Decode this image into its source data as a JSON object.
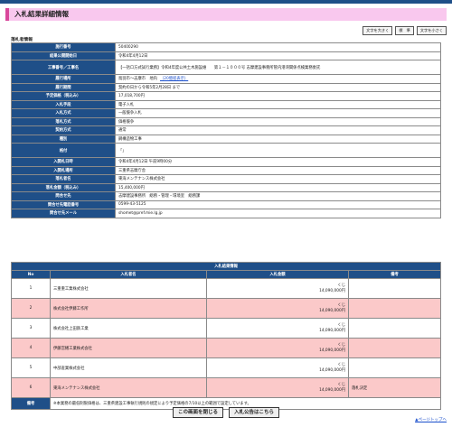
{
  "header": {
    "title": "入札結果詳細情報"
  },
  "font_size_buttons": [
    "文字を大きく",
    "標　準",
    "文字を小さく"
  ],
  "section_label": "落札者情報",
  "info_rows": [
    {
      "label": "施行番号",
      "value": "50400290"
    },
    {
      "label": "結果公開開始日",
      "value": "令和4年4月12日"
    },
    {
      "label": "工事番号／工事名",
      "value": "【一括ロ方式試行業務】令和4年度公共土木施設維　　第１－１０００号 志摩建設事務所管内港湾関係点検業務委託",
      "tall": true
    },
    {
      "label": "履行場所",
      "value": "鳥羽市～志摩市　地内",
      "link": "（20億程表示）"
    },
    {
      "label": "履行期間",
      "value": "契約の日から令和5年2月28日 まで"
    },
    {
      "label": "予定価格（税込み）",
      "value": "17,018,700円"
    },
    {
      "label": "入札手段",
      "value": "電子入札"
    },
    {
      "label": "入札方式",
      "value": "一般競争入札"
    },
    {
      "label": "落札方式",
      "value": "価格競争"
    },
    {
      "label": "契約方式",
      "value": "通常"
    },
    {
      "label": "種別",
      "value": "鋼構造物工事"
    },
    {
      "label": "格付",
      "value": "「」",
      "tall": true
    },
    {
      "label": "入開札日時",
      "value": "令和4年4月12日 午前9時00分"
    },
    {
      "label": "入開札場所",
      "value": "三重県志摩庁舎"
    },
    {
      "label": "落札者名",
      "value": "東海メンテナンス株式会社"
    },
    {
      "label": "落札金額（税込み）",
      "value": "15,400,000円"
    },
    {
      "label": "問合せ先",
      "value": "志摩建設事務所　総務・管理・環境室　総務課"
    },
    {
      "label": "問合せ先電話番号",
      "value": "0599-43-5125"
    },
    {
      "label": "問合せ先メール",
      "value": "shomet@pref.mie.lg.jp"
    }
  ],
  "results": {
    "caption": "入札結果情報",
    "columns": [
      "No",
      "入札者名",
      "入札金額",
      "備考"
    ],
    "rows": [
      {
        "no": "1",
        "name": "三重重工業株式会社",
        "amount_line1": "くじ",
        "amount_line2": "14,090,000円",
        "note": ""
      },
      {
        "no": "2",
        "name": "株式会社伊藤工作所",
        "amount_line1": "くじ",
        "amount_line2": "14,090,000円",
        "note": ""
      },
      {
        "no": "3",
        "name": "株式会社上田鉄工業",
        "amount_line1": "くじ",
        "amount_line2": "14,090,000円",
        "note": ""
      },
      {
        "no": "4",
        "name": "伊藤営繕工業株式会社",
        "amount_line1": "くじ",
        "amount_line2": "14,090,000円",
        "note": ""
      },
      {
        "no": "5",
        "name": "中部産業株式会社",
        "amount_line1": "くじ",
        "amount_line2": "14,090,000円",
        "note": ""
      },
      {
        "no": "6",
        "name": "東海メンテナンス株式会社",
        "amount_line1": "くじ",
        "amount_line2": "14,090,000円",
        "note": "落札決定"
      }
    ],
    "remarks_label": "備考",
    "remarks_value": "※本業務の最低制限価格は、三重県建設工事執行規則の規定により予定価格の7/10以上の範囲で設定しています。"
  },
  "bottom_buttons": {
    "close": "この画面を閉じる",
    "notice": "入札公告はこちら"
  },
  "page_top": "▲ページトップへ",
  "colors": {
    "header_blue": "#1f4f88",
    "title_pink": "#f9c8ee",
    "accent_magenta": "#d9489b",
    "row_pink": "#fbc9c9"
  }
}
